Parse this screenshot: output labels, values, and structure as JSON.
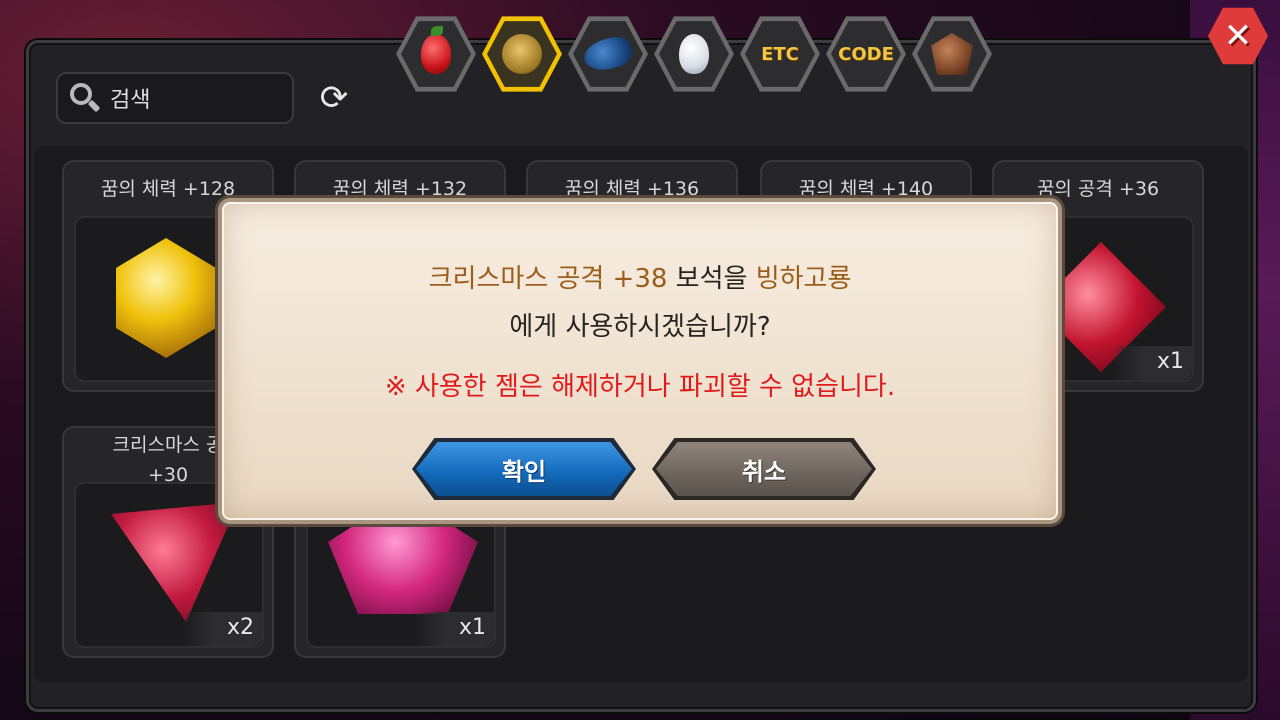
{
  "search": {
    "placeholder": "검색"
  },
  "tabs": [
    {
      "name": "fruit-tab",
      "icon": "fruit-icon",
      "label": ""
    },
    {
      "name": "gem-tab",
      "icon": "gem-icon",
      "label": "",
      "active": true
    },
    {
      "name": "fish-tab",
      "icon": "fish-icon",
      "label": ""
    },
    {
      "name": "egg-tab",
      "icon": "egg-icon",
      "label": ""
    },
    {
      "name": "etc-tab",
      "icon": "",
      "label": "ETC"
    },
    {
      "name": "code-tab",
      "icon": "",
      "label": "CODE"
    },
    {
      "name": "dragon-tab",
      "icon": "dragon-icon",
      "label": ""
    }
  ],
  "items": [
    {
      "title": "꿈의 체력 +128",
      "qty": ""
    },
    {
      "title": "꿈의 체력 +132",
      "qty": ""
    },
    {
      "title": "꿈의 체력 +136",
      "qty": ""
    },
    {
      "title": "꿈의 체력 +140",
      "qty": ""
    },
    {
      "title": "꿈의 공격 +36",
      "qty": "x1"
    },
    {
      "title": "크리스마스 공",
      "title2": "+30",
      "qty": "x2"
    },
    {
      "title": "",
      "qty": "x1"
    }
  ],
  "dialog": {
    "line1_a": "크리스마스 공격 +38",
    "line1_b": " 보석을 ",
    "line1_c": "빙하고룡",
    "line2": "에게 사용하시겠습니까?",
    "warning": "※ 사용한 젬은 해제하거나 파괴할 수 없습니다.",
    "confirm": "확인",
    "cancel": "취소"
  },
  "colors": {
    "highlight": "#9b5e1a",
    "warning": "#e11b1b",
    "confirm_button": "#1268b8",
    "cancel_button": "#6d645d",
    "tab_active": "#f2c200"
  }
}
